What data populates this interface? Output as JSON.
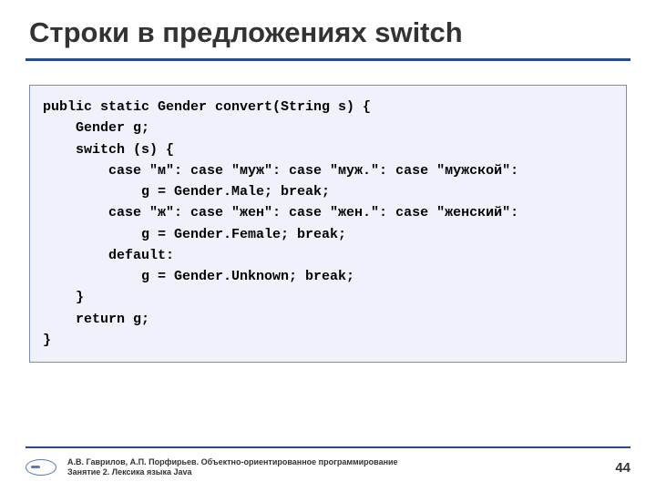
{
  "slide": {
    "title": "Строки в предложениях switch",
    "code": "public static Gender convert(String s) {\n    Gender g;\n    switch (s) {\n        case \"м\": case \"муж\": case \"муж.\": case \"мужской\":\n            g = Gender.Male; break;\n        case \"ж\": case \"жен\": case \"жен.\": case \"женский\":\n            g = Gender.Female; break;\n        default:\n            g = Gender.Unknown; break;\n    }\n    return g;\n}"
  },
  "footer": {
    "line1": "А.В. Гаврилов, А.П. Порфирьев. Объектно-ориентированное программирование",
    "line2": "Занятие 2. Лексика языка Java",
    "page": "44"
  }
}
